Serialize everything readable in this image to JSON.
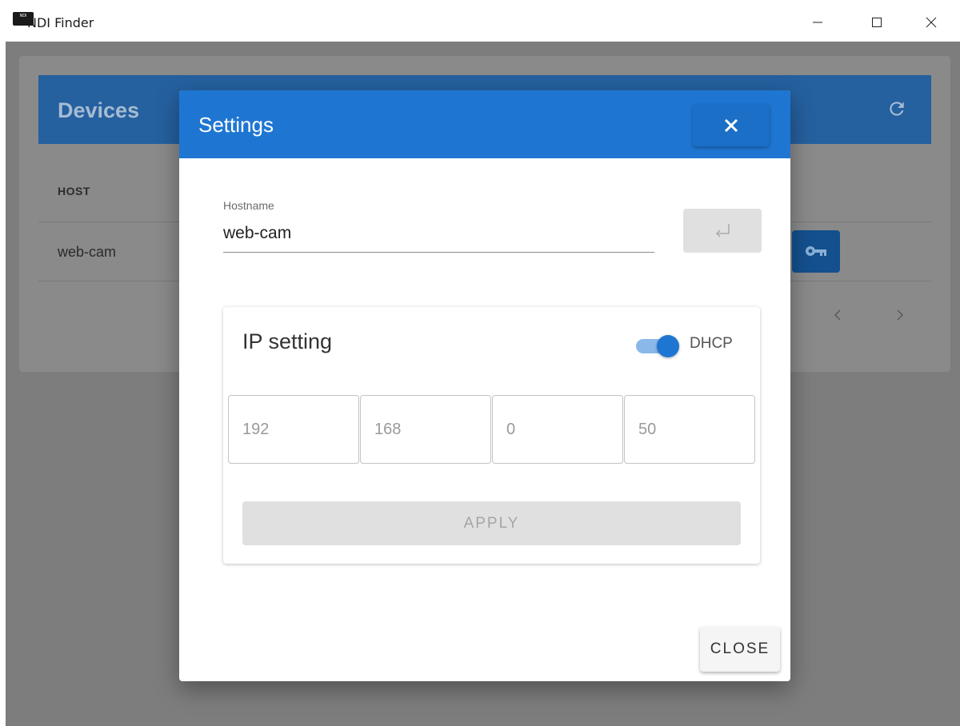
{
  "window": {
    "logo_text": "NDI",
    "title": "NDI Finder",
    "minimize_icon": "minimize-icon",
    "maximize_icon": "maximize-icon",
    "close_icon": "close-icon"
  },
  "devices": {
    "title": "Devices",
    "refresh_icon": "refresh-icon",
    "columns": [
      "HOST"
    ],
    "rows": [
      {
        "host": "web-cam",
        "action_icon": "key-icon"
      }
    ],
    "pagination": {
      "prev_icon": "chevron-left-icon",
      "next_icon": "chevron-right-icon"
    }
  },
  "settings_dialog": {
    "title": "Settings",
    "close_icon": "close-icon",
    "hostname": {
      "label": "Hostname",
      "value": "web-cam",
      "submit_icon": "enter-icon"
    },
    "ip_setting": {
      "title": "IP setting",
      "dhcp_label": "DHCP",
      "dhcp_enabled": true,
      "octets": [
        "192",
        "168",
        "0",
        "50"
      ],
      "apply_label": "APPLY"
    },
    "close_label": "CLOSE"
  },
  "colors": {
    "primary": "#1f76d2",
    "overlay": "#7d7d7d",
    "disabled": "#e0e0e0"
  }
}
